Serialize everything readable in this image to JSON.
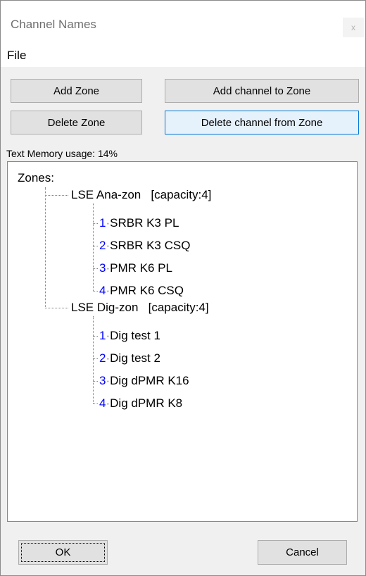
{
  "window": {
    "title": "Channel Names",
    "close_label": "x"
  },
  "menu": {
    "file": "File"
  },
  "buttons": {
    "add_zone": "Add Zone",
    "add_channel": "Add channel to Zone",
    "delete_zone": "Delete Zone",
    "delete_channel": "Delete channel from Zone",
    "ok": "OK",
    "cancel": "Cancel"
  },
  "memory_usage": "Text Memory usage: 14%",
  "tree": {
    "root": "Zones:",
    "zones": [
      {
        "label": "LSE Ana-zon   [capacity:4]",
        "channels": [
          {
            "index": "1",
            "name": "SRBR K3 PL"
          },
          {
            "index": "2",
            "name": "SRBR K3 CSQ"
          },
          {
            "index": "3",
            "name": "PMR K6 PL"
          },
          {
            "index": "4",
            "name": "PMR K6 CSQ"
          }
        ]
      },
      {
        "label": "LSE Dig-zon   [capacity:4]",
        "channels": [
          {
            "index": "1",
            "name": "Dig test 1"
          },
          {
            "index": "2",
            "name": "Dig test 2"
          },
          {
            "index": "3",
            "name": "Dig dPMR K16"
          },
          {
            "index": "4",
            "name": "Dig dPMR K8"
          }
        ]
      }
    ]
  }
}
